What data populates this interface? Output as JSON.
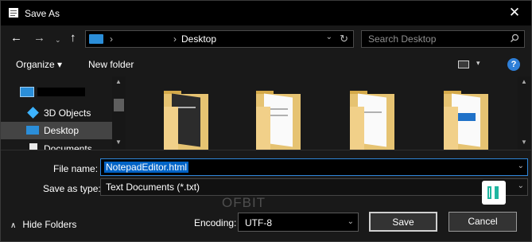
{
  "window": {
    "title": "Save As",
    "close_glyph": "✕"
  },
  "navigation": {
    "back_glyph": "←",
    "forward_glyph": "→",
    "recent_glyph": "⌄",
    "up_glyph": "↑",
    "path_separator": "›",
    "path_current": "Desktop",
    "dropdown_glyph": "⌄",
    "refresh_glyph": "↻",
    "search_placeholder": "Search Desktop"
  },
  "toolbar": {
    "organize_label": "Organize ▾",
    "new_folder_label": "New folder",
    "view_caret": "▾",
    "help_glyph": "?"
  },
  "sidebar": {
    "items": [
      {
        "label": "3D Objects"
      },
      {
        "label": "Desktop",
        "selected": true
      },
      {
        "label": "Documents"
      }
    ]
  },
  "form": {
    "filename_label": "File name:",
    "filename_value": "NotepadEditor.html",
    "type_label": "Save as type:",
    "type_value": "Text Documents (*.txt)",
    "encoding_label": "Encoding:",
    "encoding_value": "UTF-8",
    "hide_folders_label": "Hide Folders",
    "hide_folders_glyph": "∧",
    "save_label": "Save",
    "cancel_label": "Cancel",
    "caret_glyph": "⌄"
  },
  "watermark": {
    "text": "OFBIT"
  },
  "colors": {
    "accent": "#0063c6",
    "background": "#191919",
    "folder": "#e6c372"
  }
}
